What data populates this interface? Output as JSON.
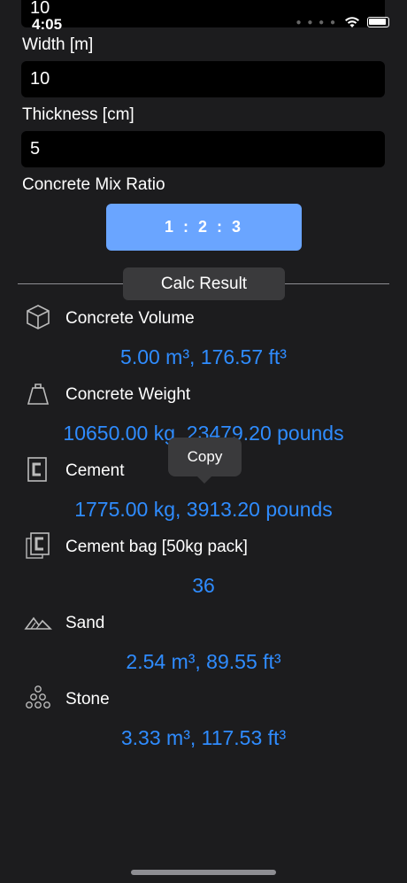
{
  "status": {
    "time": "4:05"
  },
  "length_field": {
    "value": "10"
  },
  "width": {
    "label": "Width [m]",
    "value": "10"
  },
  "thickness": {
    "label": "Thickness [cm]",
    "value": "5"
  },
  "mix": {
    "label": "Concrete Mix Ratio",
    "button": "1 : 2 : 3"
  },
  "calc": {
    "label": "Calc Result"
  },
  "results": [
    {
      "label": "Concrete Volume",
      "value": "5.00 m³, 176.57 ft³",
      "icon": "cube-icon"
    },
    {
      "label": "Concrete Weight",
      "value": "10650.00 kg, 23479.20 pounds",
      "icon": "weight-icon"
    },
    {
      "label": "Cement",
      "value": "1775.00 kg, 3913.20 pounds",
      "icon": "cement-icon"
    },
    {
      "label": "Cement bag [50kg pack]",
      "value": "36",
      "icon": "cement-bag-icon"
    },
    {
      "label": "Sand",
      "value": "2.54 m³, 89.55 ft³",
      "icon": "sand-icon"
    },
    {
      "label": "Stone",
      "value": "3.33 m³, 117.53 ft³",
      "icon": "stone-icon"
    }
  ],
  "tooltip": {
    "label": "Copy"
  },
  "colors": {
    "accent": "#2f8cff",
    "button": "#6aa5ff",
    "background": "#1c1c1e"
  }
}
